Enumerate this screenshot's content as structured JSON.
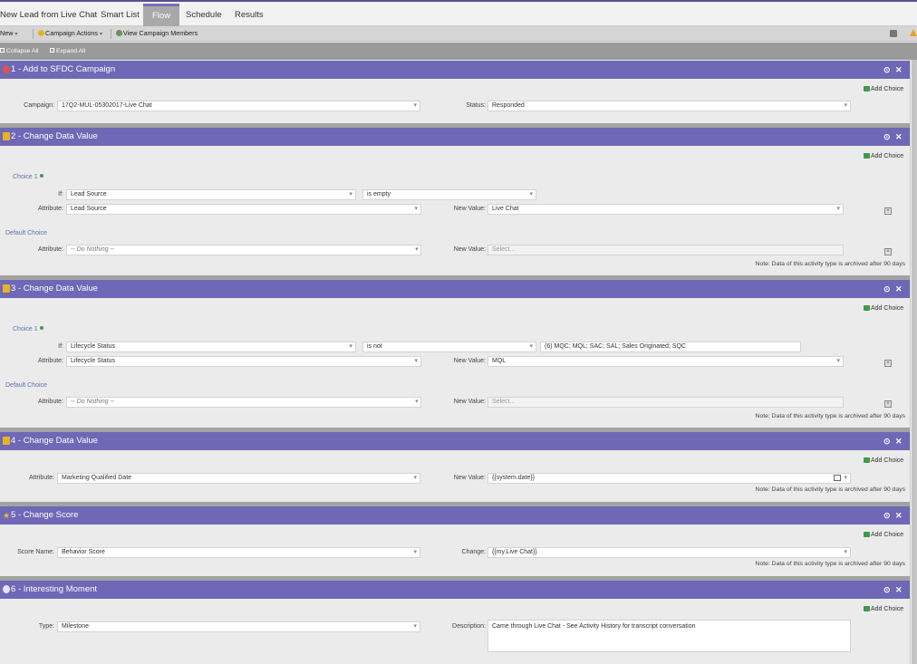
{
  "tabs": [
    {
      "label": "New Lead from Live Chat"
    },
    {
      "label": "Smart List"
    },
    {
      "label": "Flow"
    },
    {
      "label": "Schedule"
    },
    {
      "label": "Results"
    }
  ],
  "toolbar": {
    "new_label": "New",
    "campaign_actions_label": "Campaign Actions",
    "view_members_label": "View Campaign Members"
  },
  "collapse": {
    "collapse_all": "Collapse All",
    "expand_all": "Expand All"
  },
  "common": {
    "add_choice": "Add Choice",
    "archive_note": "Note: Data of this activity type is archived after 90 days",
    "choice1": "Choice 1",
    "default_choice": "Default Choice",
    "if_label": "If:",
    "attribute_label": "Attribute:",
    "new_value_label": "New Value:",
    "do_nothing": "-- Do Nothing --",
    "select_placeholder": "Select..."
  },
  "steps": [
    {
      "title": "1 - Add to SFDC Campaign",
      "campaign_label": "Campaign:",
      "campaign_value": "17Q2-MUL-05302017-Live Chat",
      "status_label": "Status:",
      "status_value": "Responded"
    },
    {
      "title": "2 - Change Data Value",
      "if_field": "Lead Source",
      "if_operator": "is empty",
      "attribute": "Lead Source",
      "new_value": "Live Chat"
    },
    {
      "title": "3 - Change Data Value",
      "if_field": "Lifecycle Status",
      "if_operator": "is not",
      "if_value": "(6) MQC; MQL; SAC; SAL; Sales Originated; SQC",
      "attribute": "Lifecycle Status",
      "new_value": "MQL"
    },
    {
      "title": "4 - Change Data Value",
      "attribute": "Marketing Qualified Date",
      "new_value": "{{system.date}}"
    },
    {
      "title": "5 - Change Score",
      "score_label": "Score Name:",
      "score_value": "Behavior Score",
      "change_label": "Change:",
      "change_value": "{{my.Live Chat}}"
    },
    {
      "title": "6 - Interesting Moment",
      "type_label": "Type:",
      "type_value": "Milestone",
      "description_label": "Description:",
      "description_value": "Came through Live Chat - See Activity History for transcript conversation"
    }
  ],
  "colors": {
    "header_purple": "#6e68b6",
    "accent_green": "#3d9b46"
  }
}
